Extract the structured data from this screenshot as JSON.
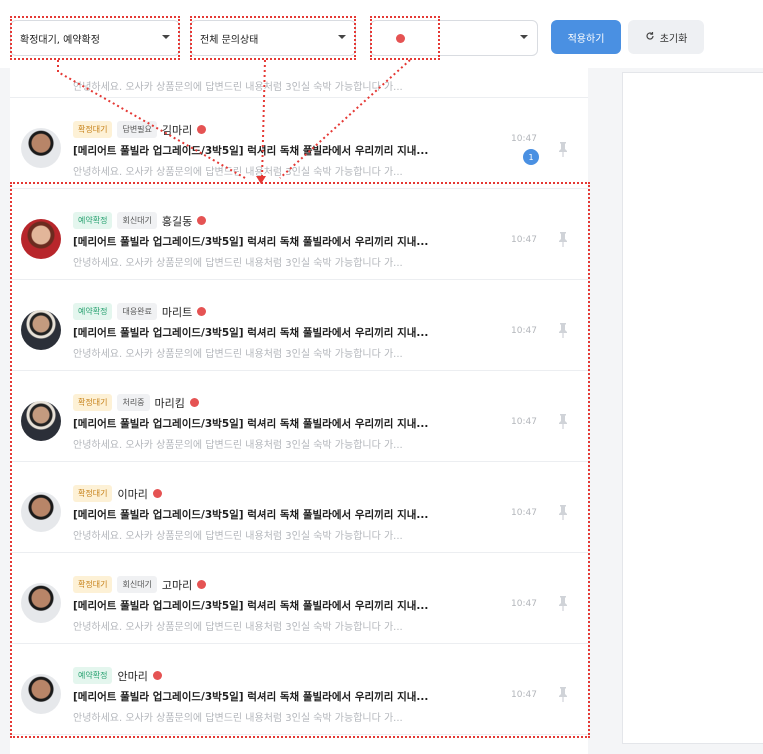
{
  "filters": {
    "reservation_status": "확정대기, 예약확정",
    "inquiry_status": "전체 문의상태",
    "apply_label": "적용하기",
    "reset_label": "초기화"
  },
  "colors": {
    "accent": "#4a90e2",
    "annotation": "#e53935",
    "unread_dot": "#e55353"
  },
  "messages": [
    {
      "badges": [],
      "name": "",
      "title": "",
      "preview": "안녕하세요. 오사카 상품문의에 답변드린 내용처럼 3인실 숙박 가능합니다 가...",
      "time": "",
      "unread": ""
    },
    {
      "badges": [
        {
          "text": "확정대기",
          "kind": "wait"
        },
        {
          "text": "답변필요",
          "kind": "gray"
        }
      ],
      "name": "김마리",
      "title": "[메리어트 풀빌라 업그레이드/3박5일] 럭셔리 독채 풀빌라에서 우리끼리 지내...",
      "preview": "안녕하세요. 오사카 상품문의에 답변드린 내용처럼 3인실 숙박 가능합니다 가...",
      "time": "10:47",
      "unread": "1",
      "avatar": "dark"
    },
    {
      "badges": [
        {
          "text": "예약확정",
          "kind": "conf"
        },
        {
          "text": "회신대기",
          "kind": "gray"
        }
      ],
      "name": "홍길동",
      "title": "[메리어트 풀빌라 업그레이드/3박5일] 럭셔리 독채 풀빌라에서 우리끼리 지내...",
      "preview": "안녕하세요. 오사카 상품문의에 답변드린 내용처럼 3인실 숙박 가능합니다 가...",
      "time": "10:47",
      "unread": "",
      "avatar": "female"
    },
    {
      "badges": [
        {
          "text": "예약확정",
          "kind": "conf"
        },
        {
          "text": "대응완료",
          "kind": "gray"
        }
      ],
      "name": "마리트",
      "title": "[메리어트 풀빌라 업그레이드/3박5일] 럭셔리 독채 풀빌라에서 우리끼리 지내...",
      "preview": "안녕하세요. 오사카 상품문의에 답변드린 내용처럼 3인실 숙박 가능합니다 가...",
      "time": "10:47",
      "unread": "",
      "avatar": "suit"
    },
    {
      "badges": [
        {
          "text": "확정대기",
          "kind": "wait"
        },
        {
          "text": "처리중",
          "kind": "gray"
        }
      ],
      "name": "마리킴",
      "title": "[메리어트 풀빌라 업그레이드/3박5일] 럭셔리 독채 풀빌라에서 우리끼리 지내...",
      "preview": "안녕하세요. 오사카 상품문의에 답변드린 내용처럼 3인실 숙박 가능합니다 가...",
      "time": "10:47",
      "unread": "",
      "avatar": "suit"
    },
    {
      "badges": [
        {
          "text": "확정대기",
          "kind": "wait"
        }
      ],
      "name": "이마리",
      "title": "[메리어트 풀빌라 업그레이드/3박5일] 럭셔리 독채 풀빌라에서 우리끼리 지내...",
      "preview": "안녕하세요. 오사카 상품문의에 답변드린 내용처럼 3인실 숙박 가능합니다 가...",
      "time": "10:47",
      "unread": "",
      "avatar": "dark"
    },
    {
      "badges": [
        {
          "text": "확정대기",
          "kind": "wait"
        },
        {
          "text": "회신대기",
          "kind": "gray"
        }
      ],
      "name": "고마리",
      "title": "[메리어트 풀빌라 업그레이드/3박5일] 럭셔리 독채 풀빌라에서 우리끼리 지내...",
      "preview": "안녕하세요. 오사카 상품문의에 답변드린 내용처럼 3인실 숙박 가능합니다 가...",
      "time": "10:47",
      "unread": "",
      "avatar": "dark"
    },
    {
      "badges": [
        {
          "text": "예약확정",
          "kind": "conf"
        }
      ],
      "name": "안마리",
      "title": "[메리어트 풀빌라 업그레이드/3박5일] 럭셔리 독채 풀빌라에서 우리끼리 지내...",
      "preview": "안녕하세요. 오사카 상품문의에 답변드린 내용처럼 3인실 숙박 가능합니다 가...",
      "time": "10:47",
      "unread": "",
      "avatar": "dark"
    }
  ]
}
